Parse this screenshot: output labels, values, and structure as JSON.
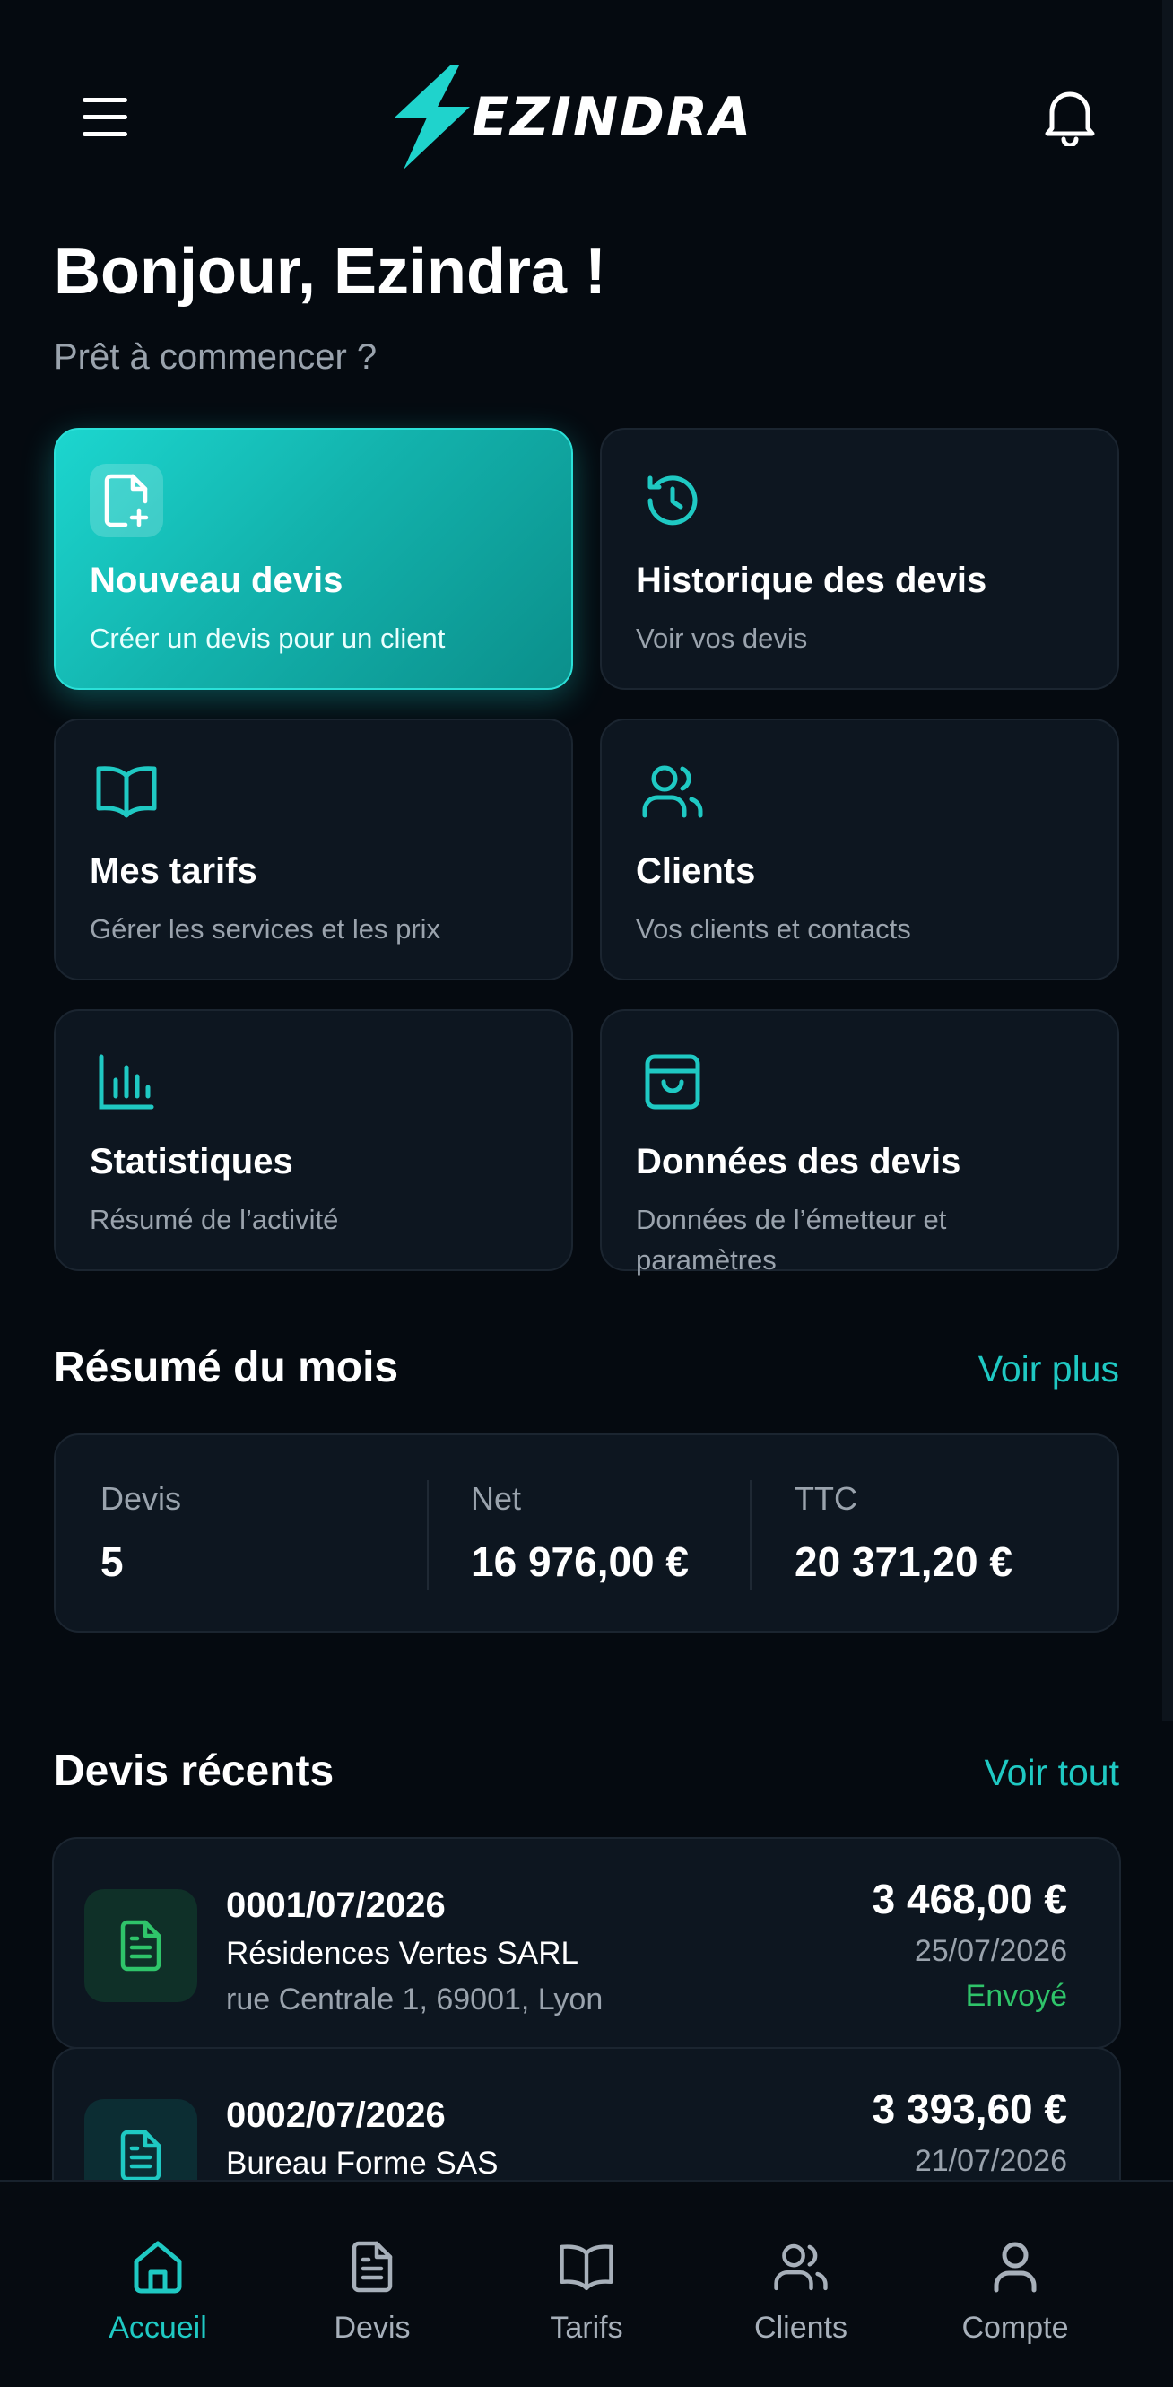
{
  "header": {
    "brand": "EZINDRA",
    "menu_icon": "menu-icon",
    "notification_icon": "bell-icon"
  },
  "greeting": {
    "title": "Bonjour, Ezindra !",
    "subtitle": "Prêt à commencer ?"
  },
  "cards": [
    {
      "title": "Nouveau devis",
      "subtitle": "Créer un devis pour un client",
      "icon": "file-plus-icon"
    },
    {
      "title": "Historique des devis",
      "subtitle": "Voir vos devis",
      "icon": "history-icon"
    },
    {
      "title": "Mes tarifs",
      "subtitle": "Gérer les services et les prix",
      "icon": "book-icon"
    },
    {
      "title": "Clients",
      "subtitle": "Vos clients et contacts",
      "icon": "users-icon"
    },
    {
      "title": "Statistiques",
      "subtitle": "Résumé de l’activité",
      "icon": "bar-chart-icon"
    },
    {
      "title": "Données des devis",
      "subtitle": "Données de l’émetteur et paramètres",
      "icon": "inbox-icon"
    }
  ],
  "summary": {
    "title": "Résumé du mois",
    "link": "Voir plus",
    "stats": [
      {
        "label": "Devis",
        "value": "5"
      },
      {
        "label": "Net",
        "value": "16 976,00 €"
      },
      {
        "label": "TTC",
        "value": "20 371,20 €"
      }
    ]
  },
  "recent": {
    "title": "Devis récents",
    "link": "Voir tout",
    "items": [
      {
        "number": "0001/07/2026",
        "client": "Résidences Vertes SARL",
        "address": "rue Centrale 1, 69001, Lyon",
        "amount": "3 468,00 €",
        "date": "25/07/2026",
        "status": "Envoyé"
      },
      {
        "number": "0002/07/2026",
        "client": "Bureau Forme SAS",
        "address": "",
        "amount": "3 393,60 €",
        "date": "21/07/2026",
        "status": ""
      }
    ]
  },
  "bottom_nav": [
    {
      "label": "Accueil",
      "icon": "home-icon",
      "active": true
    },
    {
      "label": "Devis",
      "icon": "document-icon",
      "active": false
    },
    {
      "label": "Tarifs",
      "icon": "book-icon",
      "active": false
    },
    {
      "label": "Clients",
      "icon": "users-icon",
      "active": false
    },
    {
      "label": "Compte",
      "icon": "user-icon",
      "active": false
    }
  ],
  "colors": {
    "accent": "#1fc9c3",
    "background": "#050a10",
    "card": "#0d1620",
    "status_sent": "#2fc46a"
  }
}
